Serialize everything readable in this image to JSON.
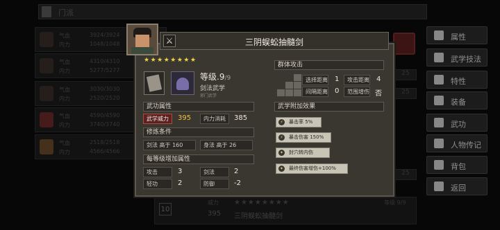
{
  "background": {
    "top_title": "门派",
    "rows": [
      {
        "l1": "气血",
        "v1": "3924/3924",
        "l2": "内力",
        "v2": "1048/1048"
      },
      {
        "l1": "气血",
        "v1": "4310/4310",
        "l2": "内力",
        "v2": "5277/5277"
      },
      {
        "l1": "气血",
        "v1": "3030/3030",
        "l2": "内力",
        "v2": "2520/2520"
      },
      {
        "l1": "气血",
        "v1": "4590/4590",
        "l2": "内力",
        "v2": "3740/3740"
      },
      {
        "l1": "气血",
        "v1": "2518/2518",
        "l2": "内力",
        "v2": "4566/4566"
      }
    ],
    "right_cells": [
      "25",
      "25",
      "25"
    ],
    "bottom": {
      "num": "10",
      "label1": "威力",
      "value1": "395",
      "stars": "★★★★★★★★",
      "skill": "三阴蜈蚣抽髓剑",
      "level": "等级 9/9"
    }
  },
  "side_menu": [
    {
      "label": "属性",
      "icon": "person-icon"
    },
    {
      "label": "武学技法",
      "icon": "martial-icon"
    },
    {
      "label": "特性",
      "icon": "trait-icon"
    },
    {
      "label": "装备",
      "icon": "sword-icon"
    },
    {
      "label": "武功",
      "icon": "book-icon"
    },
    {
      "label": "人物传记",
      "icon": "scroll-icon"
    },
    {
      "label": "背包",
      "icon": "bag-icon"
    },
    {
      "label": "返回",
      "icon": "return-icon"
    }
  ],
  "popup": {
    "title": "三阴蜈蚣抽髓剑",
    "stars": "★★★★★★★★",
    "level_label": "等级",
    "level": ".9",
    "level_max": "/9",
    "skill_type": "剑法武学",
    "sect_name": "邪门武学",
    "sections": {
      "attrs": "武功属性",
      "requirements": "修炼条件",
      "per_level": "每等级增加属性",
      "aoe": "群体攻击",
      "effects": "武学附加效果"
    },
    "attrs": {
      "power_label": "武学威力",
      "power": "395",
      "mp_label": "内力消耗",
      "mp": "385"
    },
    "requirements": [
      {
        "label": "剑法 高于 160"
      },
      {
        "label": "身法 高于 26"
      }
    ],
    "per_level": [
      {
        "label": "攻击",
        "value": "3"
      },
      {
        "label": "剑法",
        "value": "2"
      },
      {
        "label": "轻功",
        "value": "2"
      },
      {
        "label": "防御",
        "value": "-2"
      }
    ],
    "aoe": [
      {
        "label": "选择距离",
        "value": "1"
      },
      {
        "label": "攻击距离",
        "value": "4"
      },
      {
        "label": "间隔距离",
        "value": "0"
      },
      {
        "label": "范围增伤",
        "value": "否"
      }
    ],
    "effects": [
      {
        "text": "暴击率 5%"
      },
      {
        "text": "暴击伤害 150%"
      },
      {
        "text": "封穴转内伤"
      },
      {
        "text": "最终伤害增伤+100%"
      }
    ]
  }
}
